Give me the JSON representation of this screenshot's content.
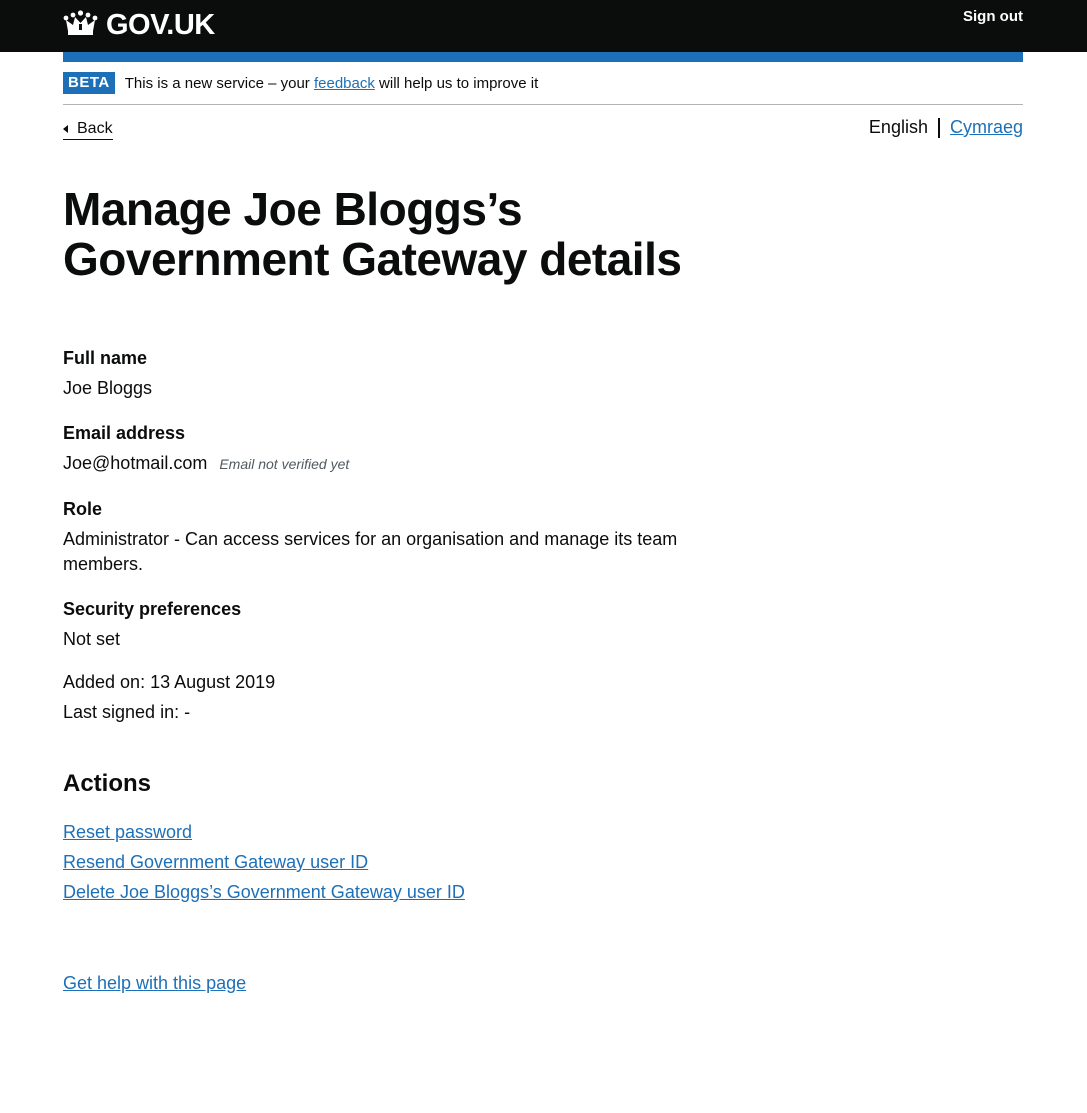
{
  "header": {
    "logo_text": "GOV.UK",
    "sign_out": "Sign out"
  },
  "phase_banner": {
    "tag": "BETA",
    "text_before": "This is a new service – your ",
    "link": "feedback",
    "text_after": " will help us to improve it"
  },
  "nav": {
    "back": "Back",
    "language_current": "English",
    "language_other": "Cymraeg"
  },
  "page": {
    "title": "Manage Joe Bloggs’s Government Gateway details"
  },
  "details": {
    "full_name_label": "Full name",
    "full_name_value": "Joe Bloggs",
    "email_label": "Email address",
    "email_value": "Joe@hotmail.com",
    "email_hint": "Email not verified yet",
    "role_label": "Role",
    "role_value": "Administrator - Can access services for an organisation and manage its team members.",
    "security_label": "Security preferences",
    "security_value": "Not set",
    "added_on": "Added on: 13 August 2019",
    "last_signed_in": "Last signed in: -"
  },
  "actions": {
    "heading": "Actions",
    "items": [
      "Reset password",
      "Resend Government Gateway user ID",
      "Delete Joe Bloggs’s Government Gateway user ID"
    ]
  },
  "footer": {
    "help_link": "Get help with this page"
  },
  "colors": {
    "header_bg": "#0b0c0c",
    "brand_blue": "#1d70b8",
    "text": "#0b0c0c"
  }
}
